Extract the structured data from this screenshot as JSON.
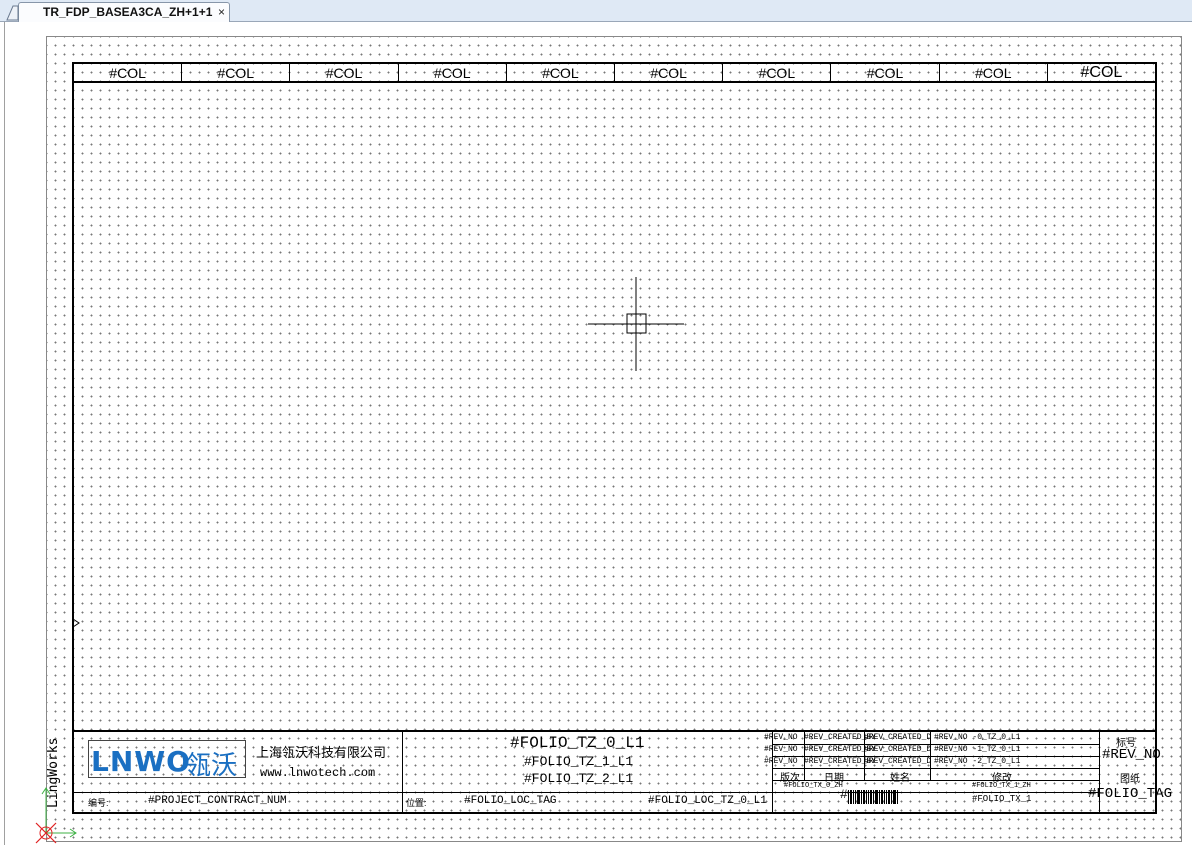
{
  "tab": {
    "title": "TR_FDP_BASEA3CA_ZH+1+1",
    "close": "×"
  },
  "columns": [
    "#COL",
    "#COL",
    "#COL",
    "#COL",
    "#COL",
    "#COL",
    "#COL",
    "#COL",
    "#COL",
    "#COL"
  ],
  "sidebar_label": "LingWorks",
  "title_block": {
    "logo_en": "LNWO",
    "logo_cn": "瓴沃",
    "company_name": "上海瓴沃科技有限公司",
    "company_url": "www.lnwotech.com",
    "folio_lines": [
      "#FOLIO_TZ_0_L1",
      "#FOLIO_TZ_1_L1",
      "#FOLIO_TZ_2_L1"
    ],
    "number_label": "编号:",
    "project_contract": "#PROJECT_CONTRACT_NUM",
    "location_label": "位置:",
    "folio_loc_tag": "#FOLIO_LOC_TAG",
    "folio_loc_tz": "#FOLIO_LOC_TZ_0_L1",
    "rev_rows": [
      {
        "no": "#REV_NO",
        "created_by": "#REV_CREATED_BY",
        "created_date": "#REV_CREATED_D",
        "desc": "#REV_NO -0_TZ_0_L1"
      },
      {
        "no": "#REV_NO",
        "created_by": "#REV_CREATED_BY",
        "created_date": "#REV_CREATED_D",
        "desc": "#REV_NO -1_TZ_0_L1"
      },
      {
        "no": "#REV_NO",
        "created_by": "#REV_CREATED_BY",
        "created_date": "#REV_CREATED_D",
        "desc": "#REV_NO -2_TZ_0_L1"
      }
    ],
    "rev_headers": {
      "version": "版次",
      "date": "日期",
      "name": "姓名",
      "modify": "修改"
    },
    "folio_tx_0": "#FOLIO_TX_0_ZH",
    "folio_tx_1_zh": "#FOLIO_TX_1_ZH",
    "folio_tx_1": "#FOLIO_TX_1",
    "barcode_hash": "#",
    "mark_label": "标号",
    "rev_no": "#REV_NO",
    "drawing_label": "图纸",
    "folio_tag": "#FOLIO_TAG"
  }
}
